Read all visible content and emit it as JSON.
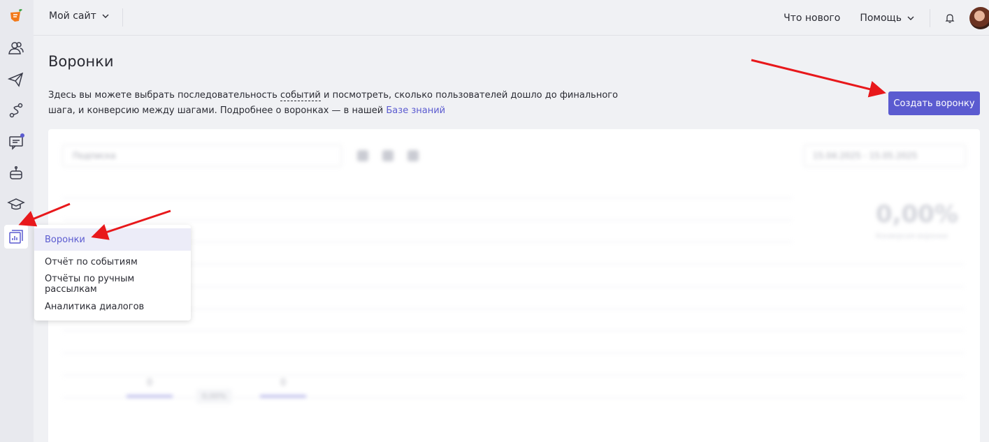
{
  "topbar": {
    "site_label": "Мой сайт",
    "whats_new": "Что нового",
    "help": "Помощь"
  },
  "page": {
    "title": "Воронки",
    "desc_part1": "Здесь вы можете выбрать последовательность ",
    "desc_link_events": "событий",
    "desc_part2": " и посмотреть, сколько пользователей дошло до финального шага, и конверсию между шагами. Подробнее о воронках — в нашей ",
    "desc_link_kb": "Базе знаний",
    "create_button": "Создать воронку"
  },
  "menu": {
    "items": [
      {
        "label": "Воронки",
        "active": true
      },
      {
        "label": "Отчёт по событиям"
      },
      {
        "label": "Отчёты по ручным рассылкам"
      },
      {
        "label": "Аналитика диалогов"
      }
    ]
  },
  "blurred_card": {
    "select_placeholder": "Подписка",
    "date_range": "15.04.2025 - 15.05.2025",
    "conversion_value": "0,00%",
    "conversion_label": "Конверсия воронки",
    "step1_value": "0",
    "step2_value": "0",
    "step_conversion": "0,00%"
  },
  "colors": {
    "accent": "#5b5bd0",
    "annotation": "#e8181b",
    "background": "#f0f1f4"
  },
  "icons": [
    "logo-icon",
    "contacts-icon",
    "mailing-icon",
    "automation-icon",
    "chat-icon",
    "bot-icon",
    "academy-icon",
    "analytics-icon",
    "bell-icon",
    "chevron-down-icon"
  ]
}
